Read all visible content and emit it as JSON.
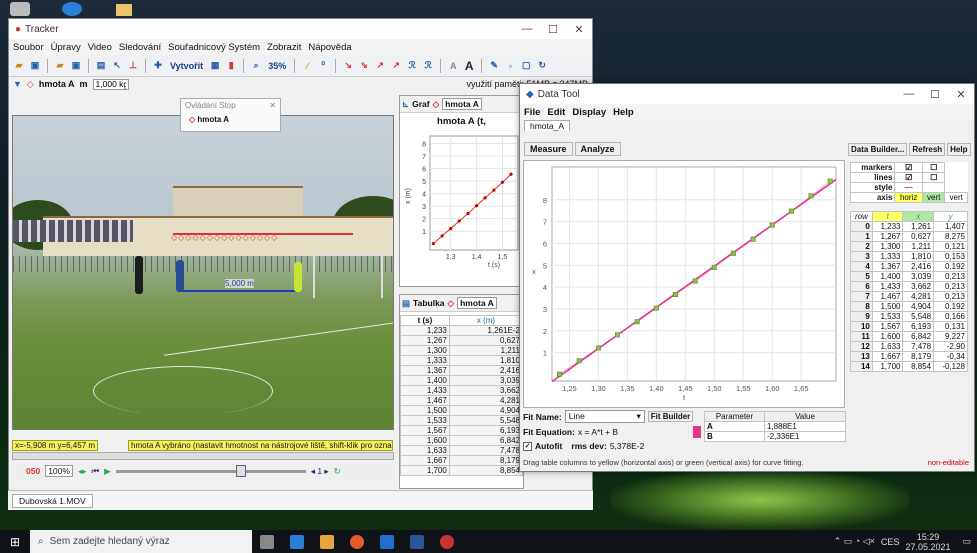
{
  "tracker": {
    "title": "Tracker",
    "menu": [
      "Soubor",
      "Úpravy",
      "Video",
      "Sledování",
      "Souřadnicový Systém",
      "Zobrazit",
      "Nápověda"
    ],
    "toolbar": {
      "create_label": "Vytvořit",
      "zoom": "35%"
    },
    "track_name": "hmota A",
    "mass_label": "m",
    "mass_value": "1,000 kg",
    "memory": "využití paměti: 51MB z 247MB",
    "control_stop": {
      "title": "Ovládání Stop",
      "item": "hmota A"
    },
    "video": {
      "tape_label": "5,000 m"
    },
    "status_coords": "x=-5,908 m  y=6,457 m",
    "status_msg": "hmota A vybráno (nastavit hmotnost na nástrojové liště, shift-klik pro označení)",
    "player": {
      "frame": "050",
      "zoom": "100%"
    },
    "tab": "Dubovská 1.MOV",
    "graph": {
      "label": "Graf",
      "track": "hmota A",
      "title": "hmota A (t,",
      "yticks": [
        "8",
        "7",
        "6",
        "5",
        "4",
        "3",
        "2",
        "1"
      ],
      "ylabel": "x (m)",
      "xticks": [
        "1,3",
        "1,4",
        "1,5"
      ],
      "xlabel": "t (s)"
    },
    "table": {
      "label": "Tabulka",
      "track": "hmota A",
      "headers": [
        "t (s)",
        "x (m)"
      ],
      "rows": [
        [
          "1,233",
          "1,261E-2"
        ],
        [
          "1,267",
          "0,627"
        ],
        [
          "1,300",
          "1,211"
        ],
        [
          "1,333",
          "1,810"
        ],
        [
          "1,367",
          "2,416"
        ],
        [
          "1,400",
          "3,039"
        ],
        [
          "1,433",
          "3,662"
        ],
        [
          "1,467",
          "4,281"
        ],
        [
          "1,500",
          "4,904"
        ],
        [
          "1,533",
          "5,548"
        ],
        [
          "1,567",
          "6,193"
        ],
        [
          "1,600",
          "6,842"
        ],
        [
          "1,633",
          "7,478"
        ],
        [
          "1,667",
          "8,179"
        ],
        [
          "1,700",
          "8,854"
        ]
      ],
      "extra": "-0,128"
    }
  },
  "datatool": {
    "title": "Data Tool",
    "menu": [
      "File",
      "Edit",
      "Display",
      "Help"
    ],
    "tab": "hmota_A",
    "measure": "Measure",
    "analyze": "Analyze",
    "builder": "Data Builder...",
    "refresh": "Refresh",
    "help": "Help",
    "chart_data": {
      "type": "scatter",
      "x": [
        1.233,
        1.267,
        1.3,
        1.333,
        1.367,
        1.4,
        1.433,
        1.467,
        1.5,
        1.533,
        1.567,
        1.6,
        1.633,
        1.667,
        1.7
      ],
      "y": [
        0.01261,
        0.627,
        1.211,
        1.81,
        2.416,
        3.039,
        3.662,
        4.281,
        4.904,
        5.548,
        6.193,
        6.842,
        7.478,
        8.179,
        8.854
      ],
      "xlim": [
        1.22,
        1.71
      ],
      "ylim": [
        -0.3,
        9.5
      ],
      "xticks": [
        "1,25",
        "1,30",
        "1,35",
        "1,40",
        "1,45",
        "1,50",
        "1,55",
        "1,60",
        "1,65"
      ],
      "yticks": [
        "8",
        "7",
        "6",
        "5",
        "4",
        "3",
        "2",
        "1"
      ],
      "xlabel": "t",
      "ylabel": "x",
      "fit": {
        "A": 18.88,
        "B": -23.36
      },
      "marker_color": "#8fbf4a",
      "fit_color": "#e0368b",
      "line_color": "#f2b3d0"
    },
    "fit": {
      "name_label": "Fit Name:",
      "name": "Line",
      "builder": "Fit Builder",
      "eq_label": "Fit Equation:",
      "eq": "x = A*t + B",
      "autofit": "Autofit",
      "rms_label": "rms dev:",
      "rms": "5,378E-2",
      "param_headers": [
        "Parameter",
        "Value"
      ],
      "params": [
        [
          "A",
          "1,888E1"
        ],
        [
          "B",
          "-2,336E1"
        ]
      ]
    },
    "hint": "Drag table columns to yellow (horizontal axis) or green (vertical axis) for curve fitting.",
    "noneditable": "non-editable",
    "props": {
      "markers": "markers",
      "lines": "lines",
      "style": "style",
      "axis": "axis",
      "horiz": "horiz",
      "vert": "vert"
    },
    "table_headers": [
      "row",
      "t",
      "x",
      "y"
    ],
    "rows": [
      [
        "0",
        "1,233",
        "1,261",
        "1,407"
      ],
      [
        "1",
        "1,267",
        "0,627",
        "8,275"
      ],
      [
        "2",
        "1,300",
        "1,211",
        "0,121"
      ],
      [
        "3",
        "1,333",
        "1,810",
        "0,153"
      ],
      [
        "4",
        "1,367",
        "2,416",
        "0,192"
      ],
      [
        "5",
        "1,400",
        "3,039",
        "0,213"
      ],
      [
        "6",
        "1,433",
        "3,662",
        "0,213"
      ],
      [
        "7",
        "1,467",
        "4,281",
        "0,213"
      ],
      [
        "8",
        "1,500",
        "4,904",
        "0,192"
      ],
      [
        "9",
        "1,533",
        "5,548",
        "0,166"
      ],
      [
        "10",
        "1,567",
        "6,193",
        "0,131"
      ],
      [
        "11",
        "1,600",
        "6,842",
        "9,227"
      ],
      [
        "12",
        "1,633",
        "7,478",
        "-2,90"
      ],
      [
        "13",
        "1,667",
        "8,179",
        "-0,34"
      ],
      [
        "14",
        "1,700",
        "8,854",
        "-0,128"
      ]
    ]
  },
  "taskbar": {
    "search": "Sem zadejte hledaný výraz",
    "lang": "CES",
    "time": "15:29",
    "date": "27.05.2021"
  }
}
